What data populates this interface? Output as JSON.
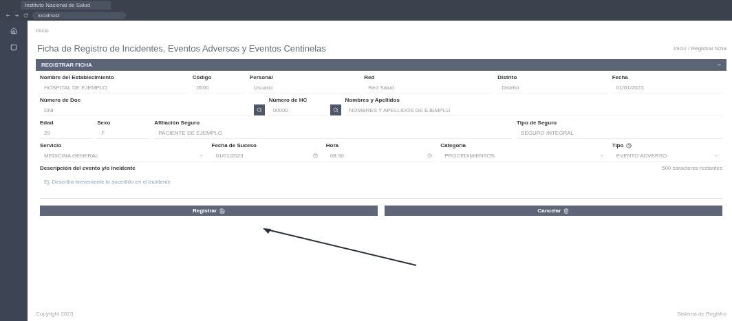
{
  "browser": {
    "tab_title": "Instituto Nacional de Salud",
    "url": "localhost"
  },
  "breadcrumb": "Inicio",
  "page_title": "Ficha de Registro de Incidentes, Eventos Adversos y Eventos Centinelas",
  "page_subtitle": "Inicio / Registrar ficha",
  "panel": {
    "title": "REGISTRAR FICHA",
    "collapse": "−"
  },
  "rows": [
    [
      {
        "label": "Nombre del Establecimiento",
        "kind": "text",
        "value": "HOSPITAL DE EJEMPLO"
      },
      {
        "label": "Código",
        "kind": "text",
        "value": "0000"
      },
      {
        "label": "Personal",
        "kind": "text",
        "value": "Usuario"
      },
      {
        "label": "Red",
        "kind": "text",
        "value": "Red Salud"
      },
      {
        "label": "Distrito",
        "kind": "text",
        "value": "Distrito"
      },
      {
        "label": "Fecha",
        "kind": "text",
        "value": "01/01/2023"
      }
    ],
    [
      {
        "label": "Número de Doc",
        "kind": "search",
        "value": "DNI"
      },
      {
        "label": "Número de HC",
        "kind": "search",
        "value": "00000"
      },
      {
        "label": "Nombres y Apellidos",
        "kind": "text",
        "value": "NOMBRES Y APELLIDOS DE EJEMPLO"
      }
    ],
    [
      {
        "label": "Edad",
        "kind": "text",
        "value": "29"
      },
      {
        "label": "Sexo",
        "kind": "text",
        "value": "F"
      },
      {
        "label": "Afiliación Seguro",
        "kind": "text",
        "value": "PACIENTE DE EJEMPLO"
      },
      {
        "label": "Tipo de Seguro",
        "kind": "text",
        "value": "SEGURO INTEGRAL"
      }
    ],
    [
      {
        "label": "Servicio",
        "kind": "select",
        "value": "MEDICINA GENERAL"
      },
      {
        "label": "Fecha de Suceso",
        "kind": "date",
        "value": "01/01/2023"
      },
      {
        "label": "Hora",
        "kind": "time",
        "value": "08:30"
      },
      {
        "label": "Categoría",
        "kind": "select",
        "value": "PROCEDIMIENTOS"
      },
      {
        "label": "Tipo",
        "kind": "select",
        "value": "EVENTO ADVERSO",
        "help": true
      }
    ]
  ],
  "description": {
    "label": "Descripción del evento y/o incidente",
    "counter": "500 caracteres restantes",
    "placeholder": "Ej. Describa brevemente lo sucedido en el incidente"
  },
  "buttons": [
    {
      "label": "Registrar"
    },
    {
      "label": "Cancelar"
    }
  ],
  "footer": {
    "left": "Copyright 2023",
    "right": "Sistema de Registro"
  }
}
